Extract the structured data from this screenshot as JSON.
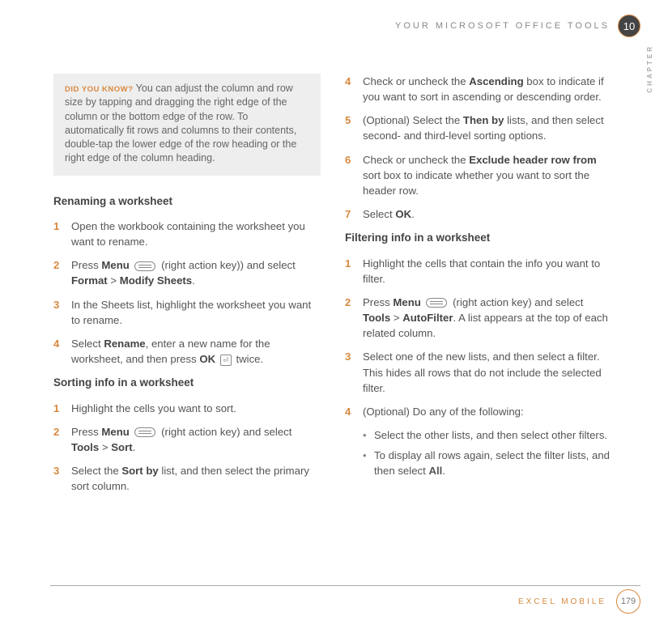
{
  "header": {
    "section_title": "YOUR MICROSOFT OFFICE TOOLS",
    "chapter_num": "10",
    "chapter_word": "CHAPTER"
  },
  "tip": {
    "title": "DID YOU KNOW?",
    "body": "  You can adjust the column and row size by tapping and dragging the right edge of the column or the bottom edge of the row. To automatically fit rows and columns to their contents, double-tap the lower edge of the row heading or the right edge of the column heading."
  },
  "left": {
    "h1": "Renaming a worksheet",
    "s1": [
      "Open the workbook containing the worksheet you want to rename.",
      "Press ",
      "Menu",
      " (right action key)) and select ",
      "Format",
      " > ",
      "Modify Sheets",
      ".",
      "In the Sheets list, highlight the worksheet you want to rename.",
      "Select ",
      "Rename",
      ", enter a new name for the worksheet, and then press ",
      "OK",
      " twice."
    ],
    "h2": "Sorting info in a worksheet",
    "s2": [
      "Highlight the cells you want to sort.",
      "Press ",
      "Menu",
      " (right action key) and select ",
      "Tools",
      " > ",
      "Sort",
      ".",
      "Select the ",
      "Sort by",
      " list, and then select the primary sort column."
    ]
  },
  "right": {
    "s1": [
      "Check or uncheck the ",
      "Ascending",
      " box to indicate if you want to sort in ascending or descending order.",
      "(Optional)  Select the ",
      "Then by",
      " lists, and then select second- and third-level sorting options.",
      "Check or uncheck the ",
      "Exclude header row from",
      " sort box to indicate whether you want to sort the header row.",
      "Select ",
      "OK",
      "."
    ],
    "h2": "Filtering info in a worksheet",
    "s2": [
      "Highlight the cells that contain the info you want to filter.",
      "Press ",
      "Menu",
      " (right action key) and select ",
      "Tools",
      " > ",
      "AutoFilter",
      ". A list appears at the top of each related column.",
      "Select one of the new lists, and then select a filter. This hides all rows that do not include the selected filter.",
      "(Optional)  Do any of the following:"
    ],
    "b1": "Select the other lists, and then select other filters.",
    "b2a": "To display all rows again, select the filter lists, and then select ",
    "b2b": "All",
    "b2c": "."
  },
  "footer": {
    "label": "EXCEL MOBILE",
    "page": "179"
  }
}
